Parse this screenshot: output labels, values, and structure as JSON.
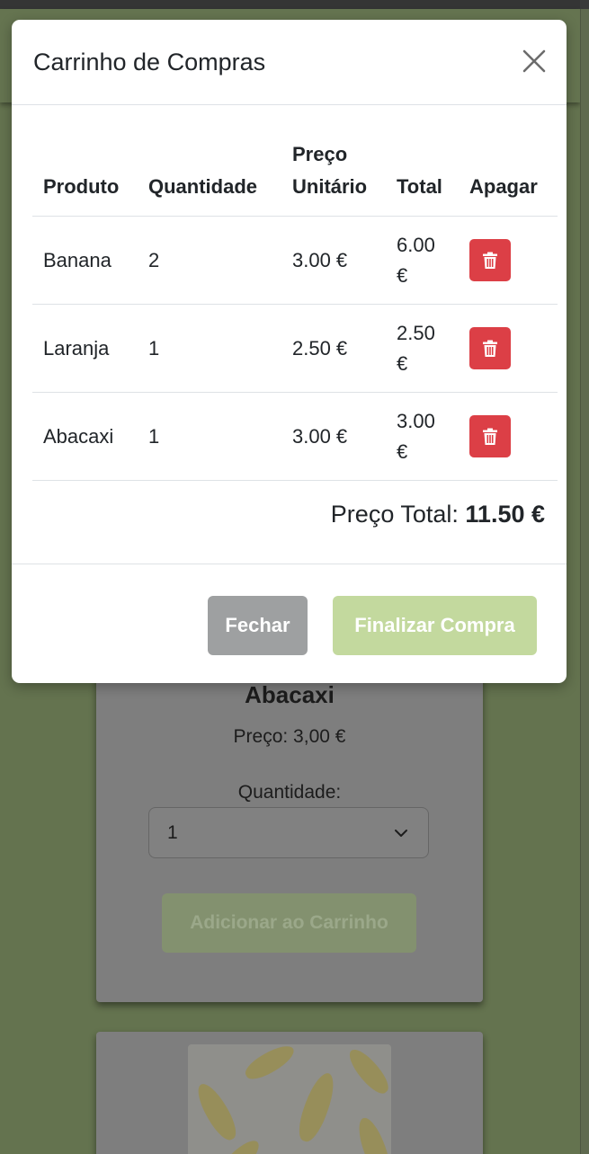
{
  "modal": {
    "title": "Carrinho de Compras",
    "table": {
      "headers": {
        "product": "Produto",
        "quantity": "Quantidade",
        "unit_price_line1": "Preço",
        "unit_price_line2": "Unitário",
        "total": "Total",
        "delete": "Apagar"
      },
      "rows": [
        {
          "product": "Banana",
          "quantity": "2",
          "unit_price": "3.00 €",
          "total_line1": "6.00",
          "total_line2": "€"
        },
        {
          "product": "Laranja",
          "quantity": "1",
          "unit_price": "2.50 €",
          "total_line1": "2.50",
          "total_line2": "€"
        },
        {
          "product": "Abacaxi",
          "quantity": "1",
          "unit_price": "3.00 €",
          "total_line1": "3.00",
          "total_line2": "€"
        }
      ]
    },
    "total_label": "Preço Total:",
    "total_value": "11.50 €",
    "buttons": {
      "close": "Fechar",
      "finalize": "Finalizar Compra"
    }
  },
  "background_card": {
    "title": "Abacaxi",
    "price": "Preço: 3,00 €",
    "quantity_label": "Quantidade:",
    "quantity_value": "1",
    "add_button": "Adicionar ao Carrinho"
  },
  "colors": {
    "delete_button": "#dc3f46",
    "finalize_button": "#c3d99e",
    "close_button": "#9ea0a1",
    "backdrop": "#6b7a55"
  },
  "icons": {
    "close": "close-icon",
    "delete": "trash-icon",
    "select": "chevron-down-icon"
  }
}
